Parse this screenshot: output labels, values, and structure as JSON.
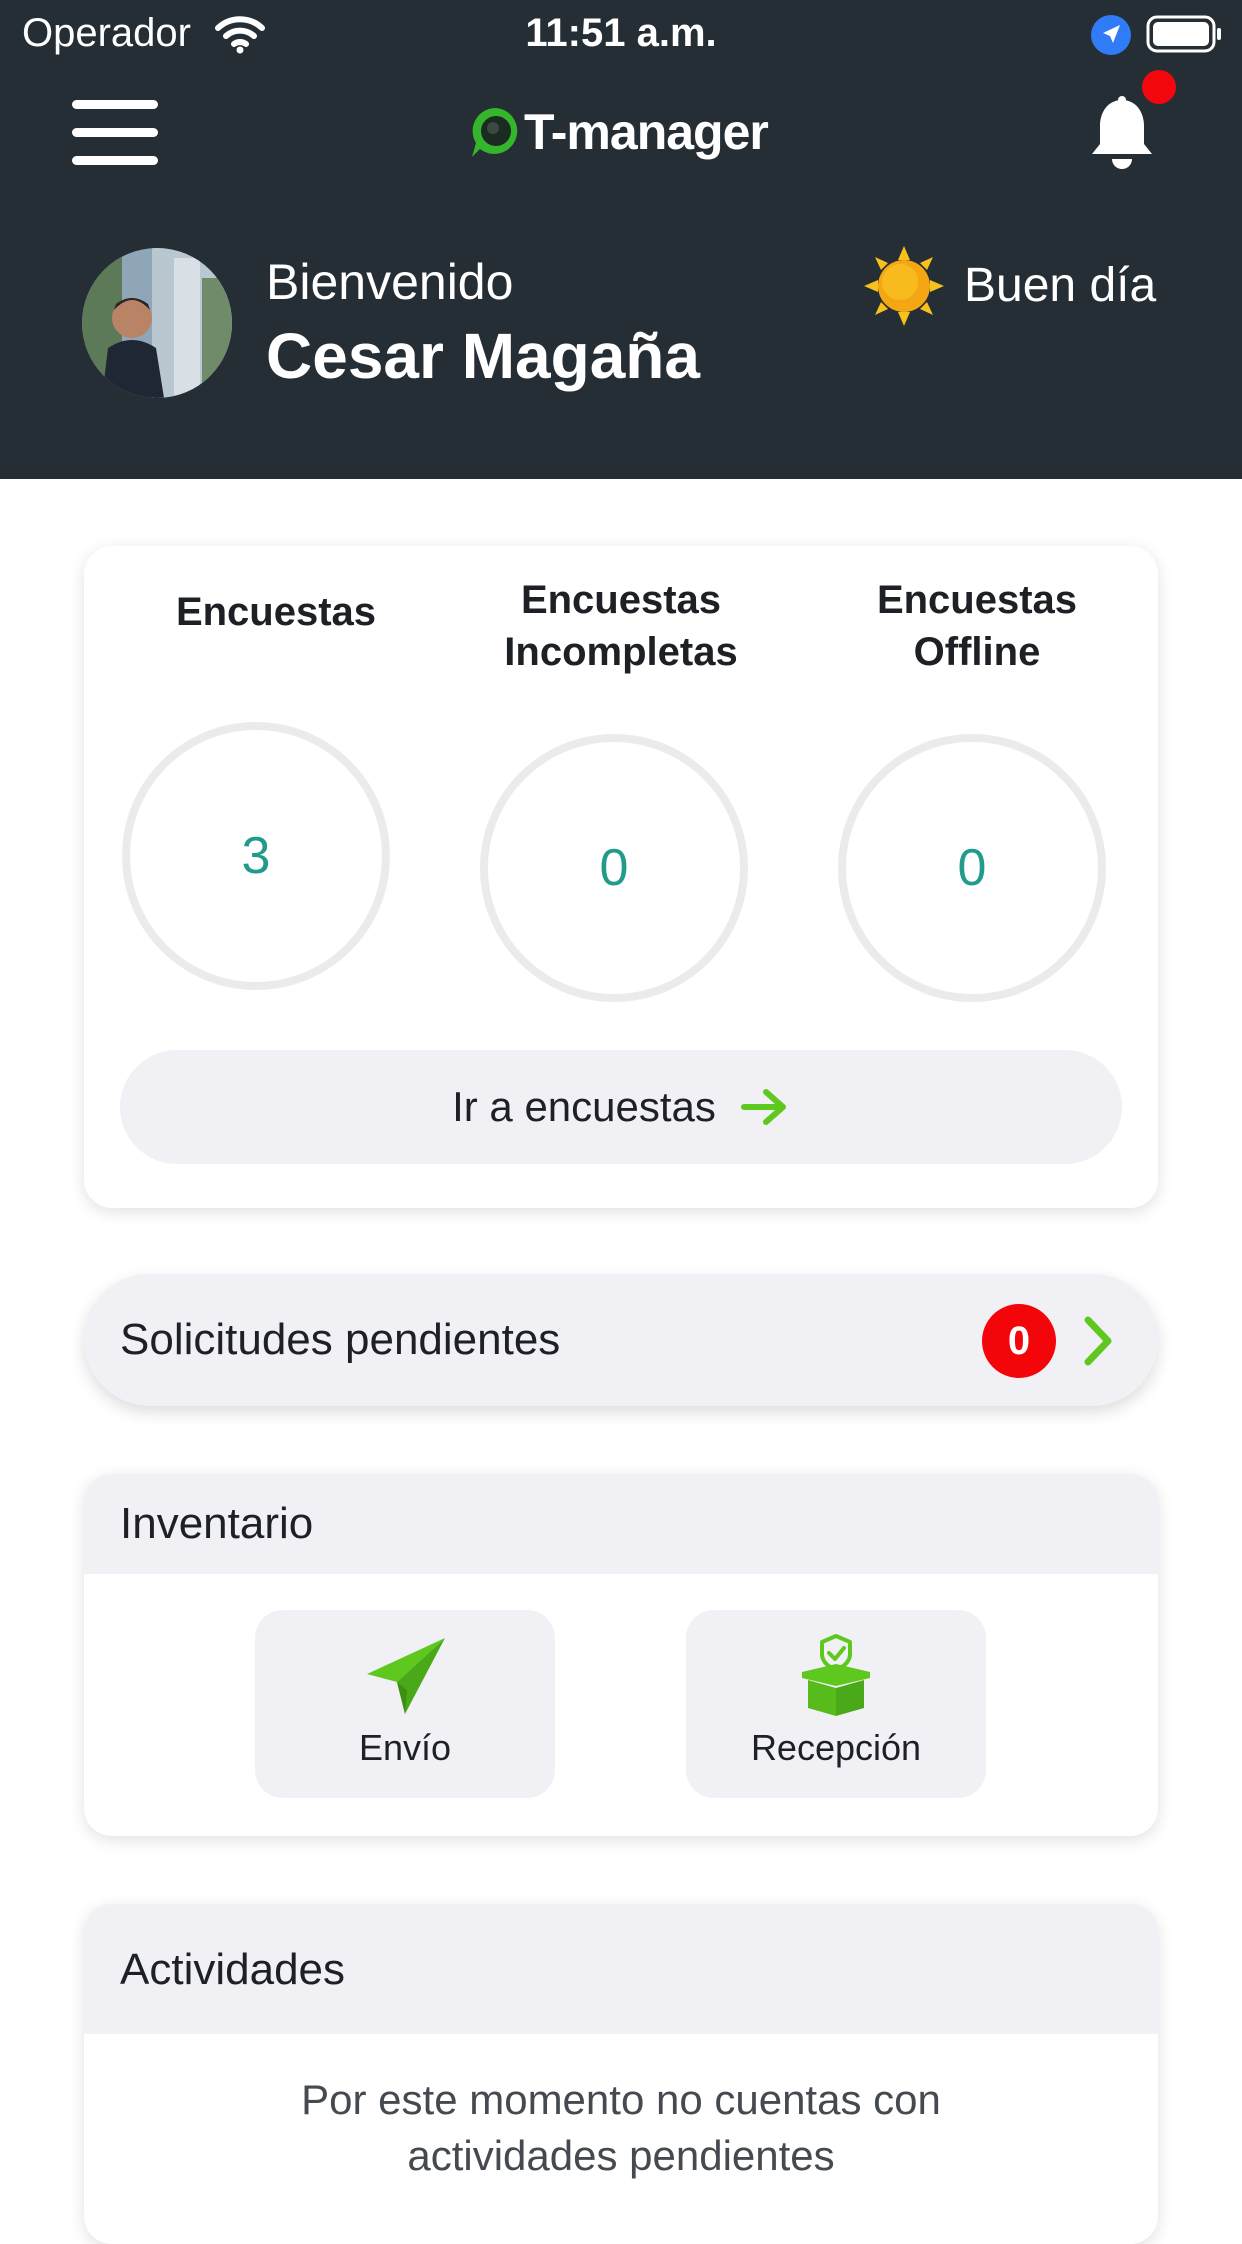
{
  "status_bar": {
    "carrier": "Operador",
    "time": "11:51 a.m."
  },
  "header": {
    "logo_text": "T-manager",
    "welcome": "Bienvenido",
    "user_name": "Cesar Magaña",
    "greeting": "Buen día",
    "notification_indicator_color": "#f2080c"
  },
  "stats": {
    "items": [
      {
        "label": "Encuestas",
        "value": "3"
      },
      {
        "label": "Encuestas\nIncompletas",
        "value": "0"
      },
      {
        "label": "Encuestas\nOffline",
        "value": "0"
      }
    ],
    "button_label": "Ir a encuestas"
  },
  "pending": {
    "label": "Solicitudes pendientes",
    "count": "0"
  },
  "inventory": {
    "title": "Inventario",
    "tiles": [
      {
        "label": "Envío",
        "icon": "send-icon"
      },
      {
        "label": "Recepción",
        "icon": "box-shield-icon"
      }
    ]
  },
  "activities": {
    "title": "Actividades",
    "empty_message": "Por este momento no cuentas con\nactividades pendientes"
  },
  "colors": {
    "header_bg": "#252d35",
    "accent_green": "#5fc81e",
    "value_teal": "#239b8a",
    "badge_red": "#f4050a",
    "surface_gray": "#f0f0f5"
  }
}
